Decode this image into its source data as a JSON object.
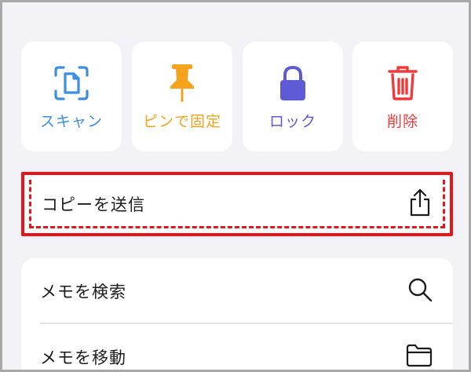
{
  "actions": [
    {
      "label": "スキャン",
      "icon": "scan-document-icon",
      "color": "#3c8fe0"
    },
    {
      "label": "ピンで固定",
      "icon": "pin-icon",
      "color": "#f5a21e"
    },
    {
      "label": "ロック",
      "icon": "lock-icon",
      "color": "#5e5ad6"
    },
    {
      "label": "削除",
      "icon": "trash-icon",
      "color": "#f2393a"
    }
  ],
  "send_copy": {
    "label": "コピーを送信",
    "icon": "share-icon"
  },
  "menu": [
    {
      "label": "メモを検索",
      "icon": "search-icon"
    },
    {
      "label": "メモを移動",
      "icon": "folder-icon"
    }
  ],
  "highlight_color": "#e8141b"
}
